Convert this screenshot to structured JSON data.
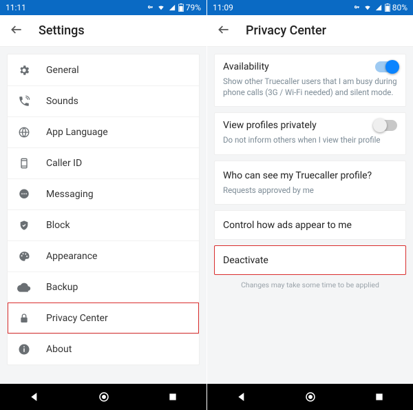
{
  "left": {
    "status": {
      "time": "11:11",
      "battery": "79%"
    },
    "appbar": {
      "title": "Settings"
    },
    "items": [
      {
        "icon": "gear",
        "label": "General"
      },
      {
        "icon": "phone",
        "label": "Sounds"
      },
      {
        "icon": "globe",
        "label": "App Language"
      },
      {
        "icon": "phone-rect",
        "label": "Caller ID"
      },
      {
        "icon": "chat",
        "label": "Messaging"
      },
      {
        "icon": "shield",
        "label": "Block"
      },
      {
        "icon": "palette",
        "label": "Appearance"
      },
      {
        "icon": "cloud",
        "label": "Backup"
      },
      {
        "icon": "lock",
        "label": "Privacy Center",
        "highlight": true
      },
      {
        "icon": "info",
        "label": "About"
      }
    ]
  },
  "right": {
    "status": {
      "time": "11:09",
      "battery": "80%"
    },
    "appbar": {
      "title": "Privacy Center"
    },
    "sections": {
      "availability": {
        "title": "Availability",
        "desc": "Show other Truecaller users that I am busy during phone calls (3G / Wi-Fi needed) and silent mode.",
        "toggle": "on"
      },
      "viewPrivately": {
        "title": "View profiles privately",
        "desc": "Do not inform others when I view their profile",
        "toggle": "off"
      },
      "whoCanSee": {
        "title": "Who can see my Truecaller profile?",
        "desc": "Requests approved by me"
      },
      "ads": {
        "title": "Control how ads appear to me"
      },
      "deactivate": {
        "title": "Deactivate",
        "highlight": true
      }
    },
    "footnote": "Changes may take some time to be applied"
  }
}
